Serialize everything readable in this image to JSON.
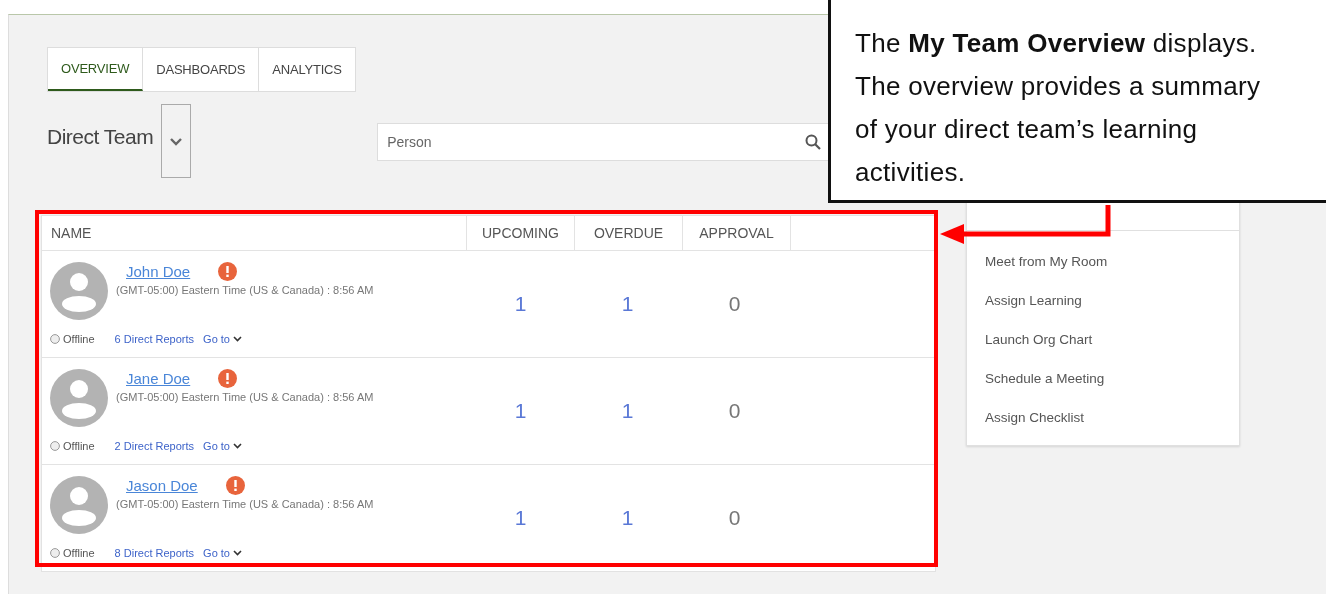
{
  "tabs": [
    {
      "label": "OVERVIEW",
      "selected": true
    },
    {
      "label": "DASHBOARDS",
      "selected": false
    },
    {
      "label": "ANALYTICS",
      "selected": false
    }
  ],
  "team_selector": {
    "label": "Direct Team"
  },
  "search": {
    "placeholder": "Person"
  },
  "table": {
    "columns": [
      "NAME",
      "UPCOMING",
      "OVERDUE",
      "APPROVAL"
    ],
    "rows": [
      {
        "name": "John Doe",
        "alert": true,
        "timezone": "(GMT-05:00) Eastern Time (US & Canada) : 8:56 AM",
        "status": "Offline",
        "direct_reports": "6 Direct Reports",
        "goto": "Go to",
        "upcoming": "1",
        "overdue": "1",
        "approval": "0"
      },
      {
        "name": "Jane Doe",
        "alert": true,
        "timezone": "(GMT-05:00) Eastern Time (US & Canada) : 8:56 AM",
        "status": "Offline",
        "direct_reports": "2 Direct Reports",
        "goto": "Go to",
        "upcoming": "1",
        "overdue": "1",
        "approval": "0"
      },
      {
        "name": "Jason Doe",
        "alert": true,
        "timezone": "(GMT-05:00) Eastern Time (US & Canada) : 8:56 AM",
        "status": "Offline",
        "direct_reports": "8 Direct Reports",
        "goto": "Go to",
        "upcoming": "1",
        "overdue": "1",
        "approval": "0"
      }
    ]
  },
  "team_actions": {
    "items": [
      "Meet from My Room",
      "Assign Learning",
      "Launch Org Chart",
      "Schedule a Meeting",
      "Assign Checklist"
    ]
  },
  "callout": {
    "text": "The **My Team Overview** displays. The overview provides a summary of your direct team’s learning activities."
  }
}
